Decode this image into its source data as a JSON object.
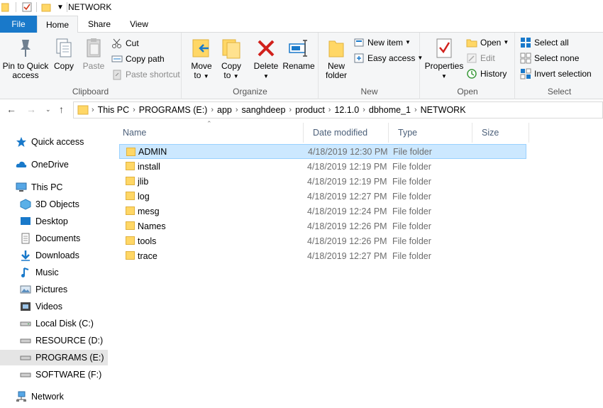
{
  "window": {
    "title": "NETWORK"
  },
  "colors": {
    "accent": "#1979ca",
    "selection_bg": "#cce8ff",
    "selection_border": "#99d1ff",
    "folder": "#ffd766"
  },
  "tabs": {
    "file": "File",
    "home": "Home",
    "share": "Share",
    "view": "View"
  },
  "ribbon": {
    "clipboard": {
      "label": "Clipboard",
      "pin_line1": "Pin to Quick",
      "pin_line2": "access",
      "copy": "Copy",
      "paste": "Paste",
      "cut": "Cut",
      "copy_path": "Copy path",
      "paste_shortcut": "Paste shortcut"
    },
    "organize": {
      "label": "Organize",
      "move_line1": "Move",
      "move_line2": "to",
      "copy_line1": "Copy",
      "copy_line2": "to",
      "delete": "Delete",
      "rename": "Rename"
    },
    "new": {
      "label": "New",
      "folder_line1": "New",
      "folder_line2": "folder",
      "new_item": "New item",
      "easy_access": "Easy access"
    },
    "open": {
      "label": "Open",
      "properties": "Properties",
      "open": "Open",
      "edit": "Edit",
      "history": "History"
    },
    "select": {
      "label": "Select",
      "select_all": "Select all",
      "select_none": "Select none",
      "invert": "Invert selection"
    }
  },
  "breadcrumb": [
    "This PC",
    "PROGRAMS (E:)",
    "app",
    "sanghdeep",
    "product",
    "12.1.0",
    "dbhome_1",
    "NETWORK"
  ],
  "sidebar": {
    "quick_access": "Quick access",
    "onedrive": "OneDrive",
    "this_pc": "This PC",
    "items": [
      "3D Objects",
      "Desktop",
      "Documents",
      "Downloads",
      "Music",
      "Pictures",
      "Videos",
      "Local Disk (C:)",
      "RESOURCE (D:)",
      "PROGRAMS (E:)",
      "SOFTWARE (F:)"
    ],
    "network": "Network"
  },
  "columns": {
    "name": "Name",
    "date": "Date modified",
    "type": "Type",
    "size": "Size"
  },
  "files": [
    {
      "name": "ADMIN",
      "date": "4/18/2019 12:30 PM",
      "type": "File folder"
    },
    {
      "name": "install",
      "date": "4/18/2019 12:19 PM",
      "type": "File folder"
    },
    {
      "name": "jlib",
      "date": "4/18/2019 12:19 PM",
      "type": "File folder"
    },
    {
      "name": "log",
      "date": "4/18/2019 12:27 PM",
      "type": "File folder"
    },
    {
      "name": "mesg",
      "date": "4/18/2019 12:24 PM",
      "type": "File folder"
    },
    {
      "name": "Names",
      "date": "4/18/2019 12:26 PM",
      "type": "File folder"
    },
    {
      "name": "tools",
      "date": "4/18/2019 12:26 PM",
      "type": "File folder"
    },
    {
      "name": "trace",
      "date": "4/18/2019 12:27 PM",
      "type": "File folder"
    }
  ]
}
